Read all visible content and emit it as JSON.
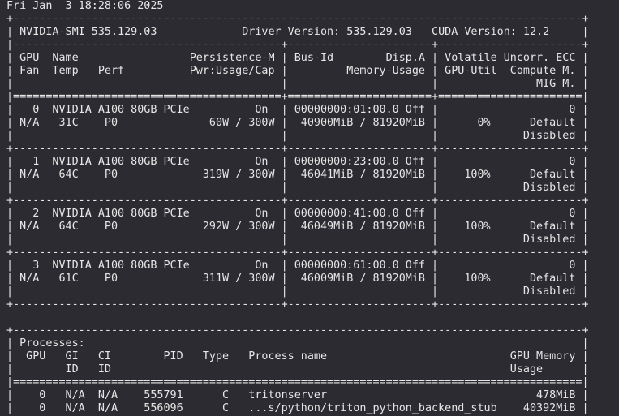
{
  "terminal": {
    "lines": [
      "Fri Jan  3 18:28:06 2025",
      "+---------------------------------------------------------------------------------------+",
      "| NVIDIA-SMI 535.129.03             Driver Version: 535.129.03   CUDA Version: 12.2     |",
      "|-----------------------------------------+----------------------+----------------------+",
      "| GPU  Name                 Persistence-M | Bus-Id        Disp.A | Volatile Uncorr. ECC |",
      "| Fan  Temp   Perf          Pwr:Usage/Cap |         Memory-Usage | GPU-Util  Compute M. |",
      "|                                         |                      |               MIG M. |",
      "|=========================================+======================+======================|",
      "|   0  NVIDIA A100 80GB PCIe          On  | 00000000:01:00.0 Off |                    0 |",
      "| N/A   31C    P0              60W / 300W |  40900MiB / 81920MiB |      0%      Default |",
      "|                                         |                      |             Disabled |",
      "+-----------------------------------------+----------------------+----------------------+",
      "|   1  NVIDIA A100 80GB PCIe          On  | 00000000:23:00.0 Off |                    0 |",
      "| N/A   64C    P0             319W / 300W |  46041MiB / 81920MiB |    100%      Default |",
      "|                                         |                      |             Disabled |",
      "+-----------------------------------------+----------------------+----------------------+",
      "|   2  NVIDIA A100 80GB PCIe          On  | 00000000:41:00.0 Off |                    0 |",
      "| N/A   64C    P0             292W / 300W |  46049MiB / 81920MiB |    100%      Default |",
      "|                                         |                      |             Disabled |",
      "+-----------------------------------------+----------------------+----------------------+",
      "|   3  NVIDIA A100 80GB PCIe          On  | 00000000:61:00.0 Off |                    0 |",
      "| N/A   61C    P0             311W / 300W |  46009MiB / 81920MiB |    100%      Default |",
      "|                                         |                      |             Disabled |",
      "+-----------------------------------------+----------------------+----------------------+",
      "",
      "+---------------------------------------------------------------------------------------+",
      "| Processes:                                                                            |",
      "|  GPU   GI   CI        PID   Type   Process name                            GPU Memory |",
      "|        ID   ID                                                             Usage      |",
      "|=======================================================================================|",
      "|    0   N/A  N/A    555791      C   tritonserver                                478MiB |",
      "|    0   N/A  N/A    556096      C   ...s/python/triton_python_backend_stub    40392MiB |"
    ]
  }
}
